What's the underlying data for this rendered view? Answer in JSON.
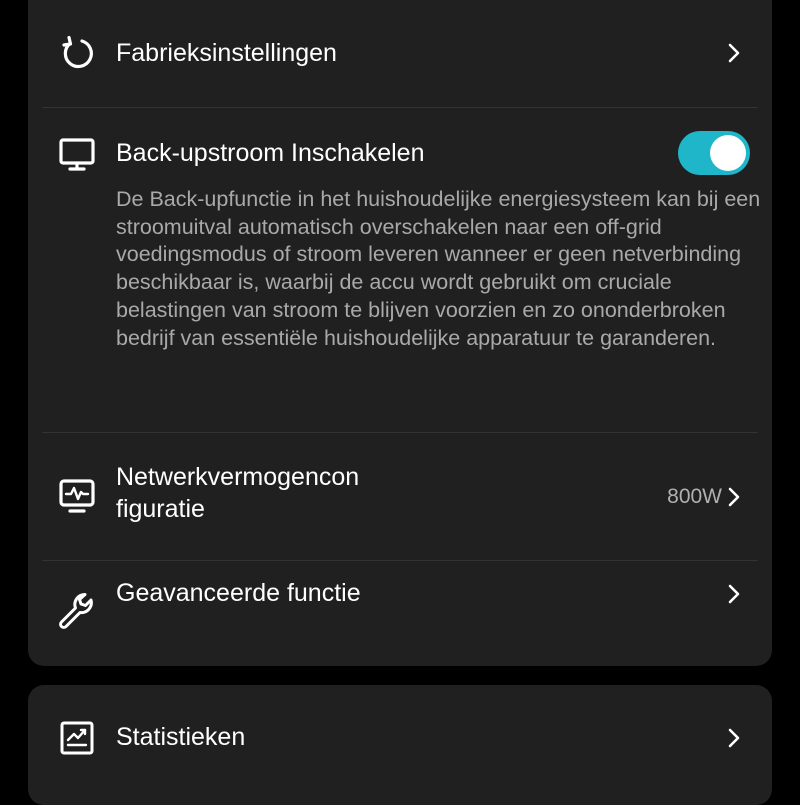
{
  "colors": {
    "background": "#000000",
    "card": "#202020",
    "toggle_on": "#1fb6c9",
    "description_text": "#a9a9a9"
  },
  "settings": {
    "factory_reset": {
      "icon": "refresh-icon",
      "label": "Fabrieksinstellingen"
    },
    "backup_power": {
      "icon": "monitor-icon",
      "label": "Back-upstroom Inschakelen",
      "enabled": true,
      "description": "De Back-upfunctie in het huishoudelijke energiesysteem kan bij een stroomuitval automatisch overschakelen naar een off-grid voedingsmodus of stroom leveren wanneer er geen netverbinding beschikbaar is, waarbij de accu wordt gebruikt om cruciale belastingen van stroom te blijven voorzien en zo ononderbroken bedrijf van essentiële huishoudelijke apparatuur te garanderen."
    },
    "network_power": {
      "icon": "pulse-monitor-icon",
      "label_line1": "Netwerkvermogencon",
      "label_line2": "figuratie",
      "value": "800W"
    },
    "advanced": {
      "icon": "wrench-icon",
      "label": "Geavanceerde functie"
    },
    "statistics": {
      "icon": "chart-icon",
      "label": "Statistieken"
    }
  }
}
